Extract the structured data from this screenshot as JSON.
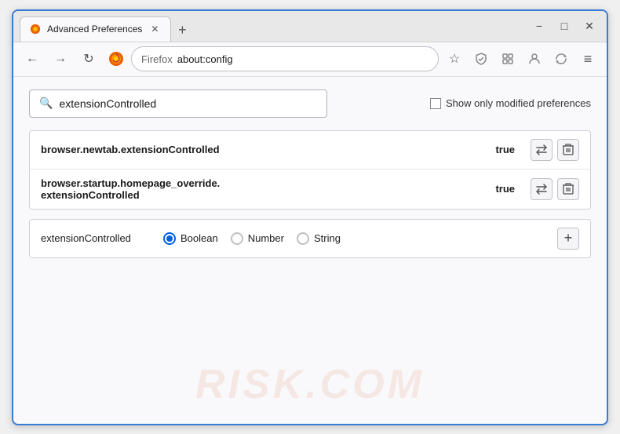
{
  "window": {
    "title": "Advanced Preferences",
    "tab_label": "Advanced Preferences",
    "new_tab_icon": "+",
    "minimize": "−",
    "maximize": "□",
    "close": "✕"
  },
  "nav": {
    "back_title": "Back",
    "forward_title": "Forward",
    "reload_title": "Reload",
    "address": "about:config",
    "address_label": "Firefox",
    "bookmark_icon": "☆",
    "pocket_icon": "shield",
    "extension_icon": "puzzle",
    "profile_icon": "person",
    "sync_icon": "sync",
    "menu_icon": "≡"
  },
  "search": {
    "placeholder": "extensionControlled",
    "value": "extensionControlled",
    "show_modified_label": "Show only modified preferences"
  },
  "results": [
    {
      "name": "browser.newtab.extensionControlled",
      "value": "true"
    },
    {
      "name": "browser.startup.homepage_override.\nextensionControlled",
      "name_line1": "browser.startup.homepage_override.",
      "name_line2": "extensionControlled",
      "value": "true",
      "multiline": true
    }
  ],
  "add_pref": {
    "name": "extensionControlled",
    "types": [
      {
        "label": "Boolean",
        "selected": true
      },
      {
        "label": "Number",
        "selected": false
      },
      {
        "label": "String",
        "selected": false
      }
    ],
    "add_btn_label": "+"
  },
  "watermark": "RISK.COM",
  "icons": {
    "search": "🔍",
    "arrows": "⇄",
    "trash": "🗑",
    "add": "+"
  }
}
